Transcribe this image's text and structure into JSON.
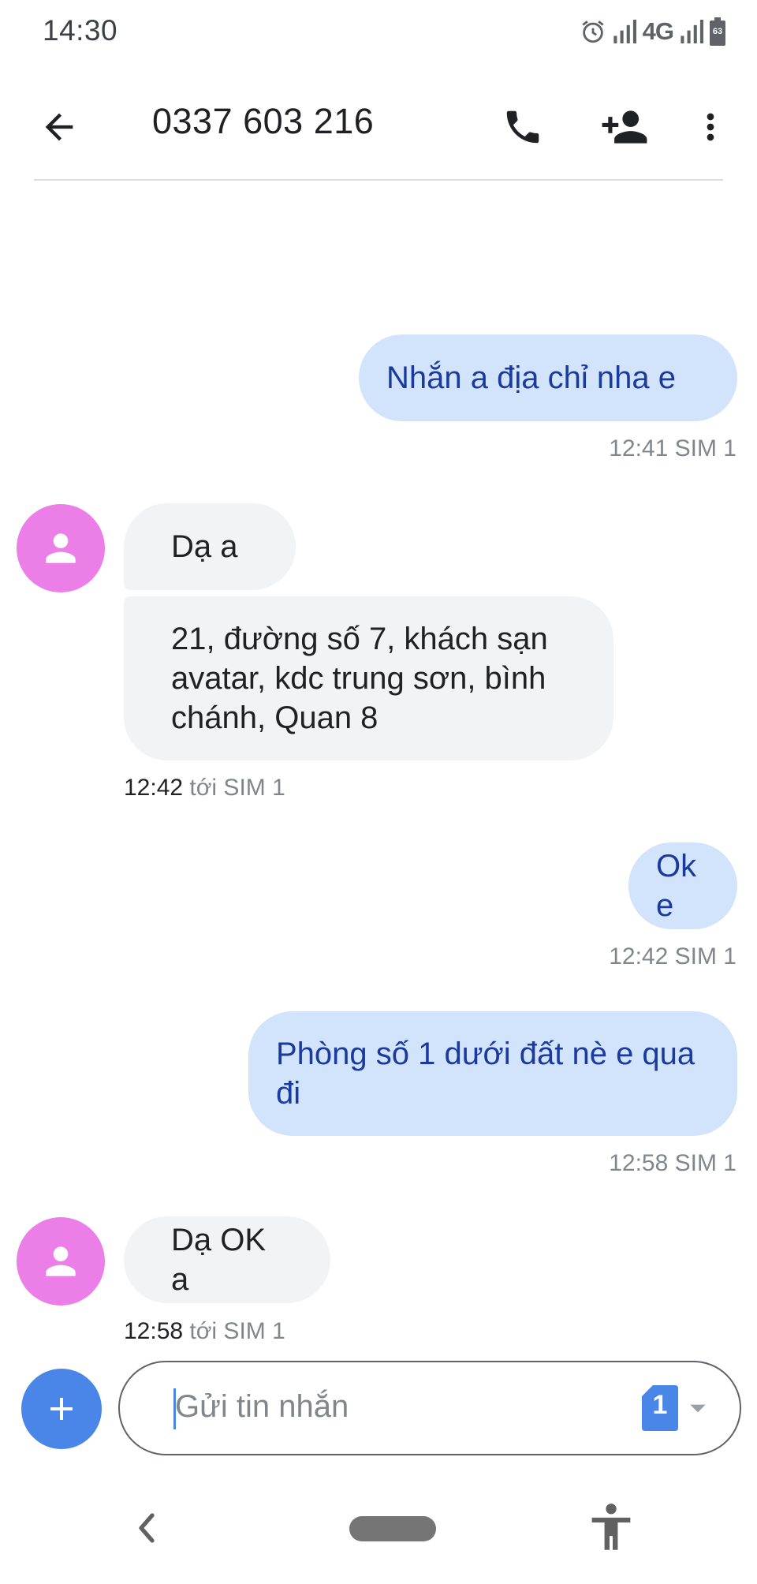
{
  "status_bar": {
    "time": "14:30",
    "network": "4G",
    "battery": "63",
    "icons": [
      "alarm-icon",
      "signal-icon",
      "signal-icon",
      "battery-icon"
    ]
  },
  "app_bar": {
    "title": "0337 603 216",
    "icons": [
      "arrow-back-icon",
      "phone-icon",
      "person-add-icon",
      "more-vert-icon"
    ]
  },
  "messages": [
    {
      "direction": "out",
      "lines": [
        "Nhắn a địa chỉ nha e"
      ],
      "time": "12:41",
      "sim": "SIM 1"
    },
    {
      "direction": "in",
      "lines": [
        "Dạ a"
      ]
    },
    {
      "direction": "in",
      "lines": [
        "21, đường số 7, khách sạn",
        "avatar, kdc trung sơn, bình",
        "chánh, Quan 8"
      ],
      "time": "12:42",
      "sim": "tới SIM 1"
    },
    {
      "direction": "out",
      "lines": [
        "Ok e"
      ],
      "time": "12:42",
      "sim": "SIM 1"
    },
    {
      "direction": "out",
      "lines": [
        "Phòng số 1 dưới đất nè e qua",
        "đi"
      ],
      "time": "12:58",
      "sim": "SIM 1"
    },
    {
      "direction": "in",
      "lines": [
        "Dạ OK a"
      ],
      "time": "12:58",
      "sim": "tới SIM 1"
    }
  ],
  "compose": {
    "placeholder": "Gửi tin nhắn",
    "sim_number": "1",
    "sim_color": "#4a86e8"
  },
  "colors": {
    "outgoing_bubble": "#d2e3fc",
    "outgoing_text": "#1a3a9e",
    "incoming_bubble": "#f1f3f4",
    "avatar": "#ec7fe7",
    "accent": "#4a86e8"
  }
}
